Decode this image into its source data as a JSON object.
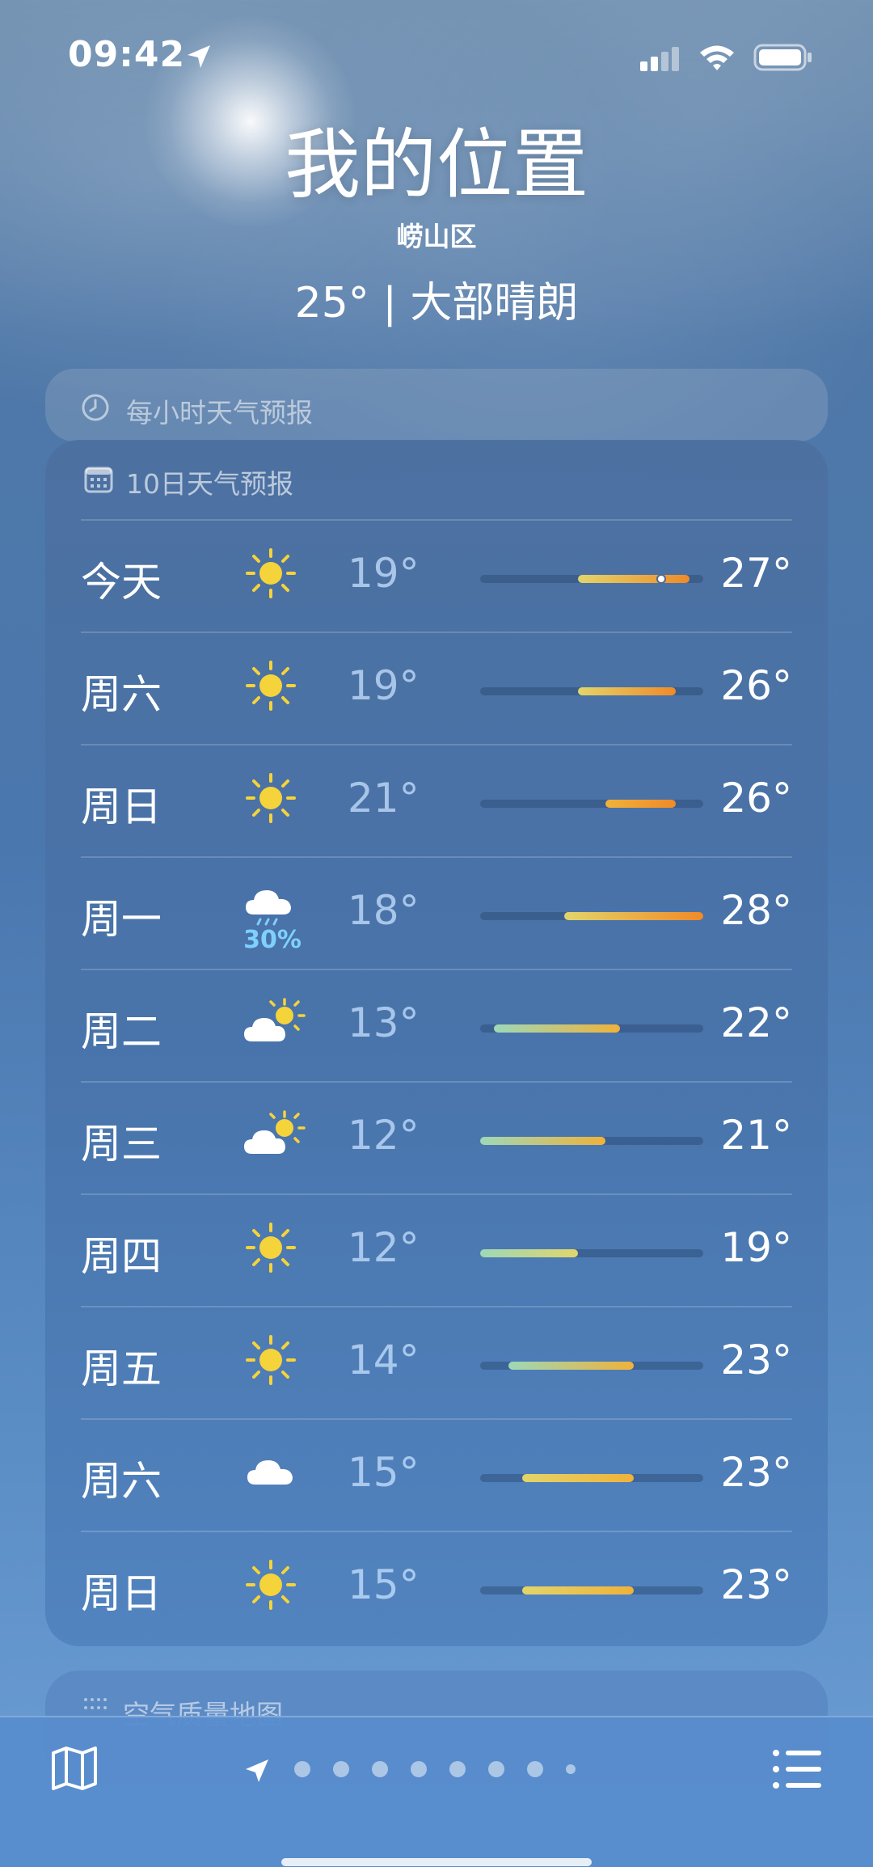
{
  "status_bar": {
    "time": "09:42"
  },
  "header": {
    "location_title": "我的位置",
    "district": "崂山区",
    "current": "25° | 大部晴朗"
  },
  "hourly_card": {
    "title": "每小时天气预报",
    "icon": "clock-icon"
  },
  "forecast_card": {
    "title": "10日天气预报",
    "icon": "calendar-icon",
    "range_min": 12,
    "range_max": 28,
    "days": [
      {
        "day": "今天",
        "icon": "sun-icon",
        "low": "19°",
        "high": "27°",
        "low_val": 19,
        "high_val": 27,
        "current_val": 25,
        "precip": ""
      },
      {
        "day": "周六",
        "icon": "sun-icon",
        "low": "19°",
        "high": "26°",
        "low_val": 19,
        "high_val": 26,
        "precip": ""
      },
      {
        "day": "周日",
        "icon": "sun-icon",
        "low": "21°",
        "high": "26°",
        "low_val": 21,
        "high_val": 26,
        "precip": ""
      },
      {
        "day": "周一",
        "icon": "rain-cloud-icon",
        "low": "18°",
        "high": "28°",
        "low_val": 18,
        "high_val": 28,
        "precip": "30%"
      },
      {
        "day": "周二",
        "icon": "partly-cloudy-icon",
        "low": "13°",
        "high": "22°",
        "low_val": 13,
        "high_val": 22,
        "precip": ""
      },
      {
        "day": "周三",
        "icon": "partly-cloudy-icon",
        "low": "12°",
        "high": "21°",
        "low_val": 12,
        "high_val": 21,
        "precip": ""
      },
      {
        "day": "周四",
        "icon": "sun-icon",
        "low": "12°",
        "high": "19°",
        "low_val": 12,
        "high_val": 19,
        "precip": ""
      },
      {
        "day": "周五",
        "icon": "sun-icon",
        "low": "14°",
        "high": "23°",
        "low_val": 14,
        "high_val": 23,
        "precip": ""
      },
      {
        "day": "周六",
        "icon": "cloud-icon",
        "low": "15°",
        "high": "23°",
        "low_val": 15,
        "high_val": 23,
        "precip": ""
      },
      {
        "day": "周日",
        "icon": "sun-icon",
        "low": "15°",
        "high": "23°",
        "low_val": 15,
        "high_val": 23,
        "precip": ""
      }
    ]
  },
  "air_quality_card": {
    "title": "空气质量地图",
    "icon": "air-quality-icon"
  },
  "bottom_bar": {
    "map_icon": "map-icon",
    "list_icon": "list-icon",
    "page_count": 9,
    "active_page": 0
  },
  "colors": {
    "sun": "#f5d33a",
    "bar_cool": "#9ed8b8",
    "bar_mid": "#e2d56a",
    "bar_warm": "#f0b23a",
    "bar_hot": "#f08a28",
    "precip": "#7fd0ff"
  }
}
